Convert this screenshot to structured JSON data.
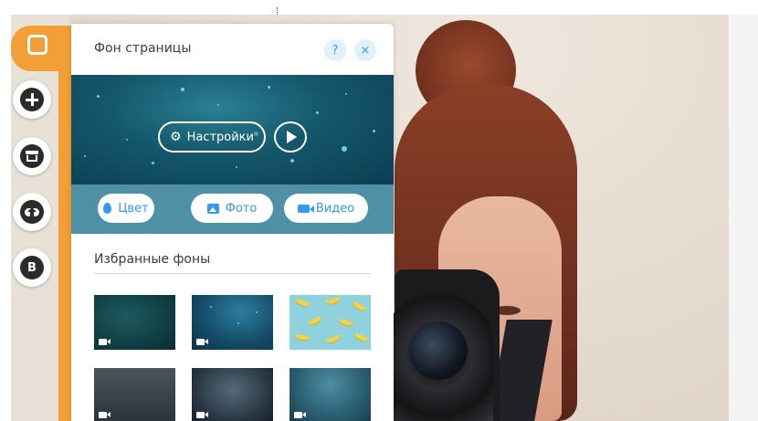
{
  "panel": {
    "title": "Фон страницы",
    "help_label": "?",
    "close_label": "×",
    "settings_label": "Настройки",
    "tabs": [
      {
        "label": "Цвет",
        "icon": "drop-icon"
      },
      {
        "label": "Фото",
        "icon": "image-icon"
      },
      {
        "label": "Видео",
        "icon": "video-camera-icon"
      }
    ],
    "section_title": "Избранные фоны",
    "thumbnails": [
      {
        "kind": "video",
        "icon": "video-icon"
      },
      {
        "kind": "video",
        "icon": "video-icon"
      },
      {
        "kind": "image"
      },
      {
        "kind": "video",
        "icon": "video-icon"
      },
      {
        "kind": "video",
        "icon": "video-icon"
      },
      {
        "kind": "video",
        "icon": "video-icon"
      }
    ]
  },
  "toolbar": {
    "items": [
      {
        "name": "background-tab",
        "icon": "square-icon"
      },
      {
        "name": "add",
        "icon": "plus-icon"
      },
      {
        "name": "store",
        "icon": "store-icon"
      },
      {
        "name": "upload",
        "icon": "cloud-upload-icon"
      },
      {
        "name": "blog",
        "icon": "blog-icon",
        "label": "B"
      }
    ]
  },
  "colors": {
    "accent": "#f29f38",
    "link_blue": "#3899ec",
    "hero_dark": "#0c3e52",
    "tabs_bar": "#4f90a6"
  }
}
